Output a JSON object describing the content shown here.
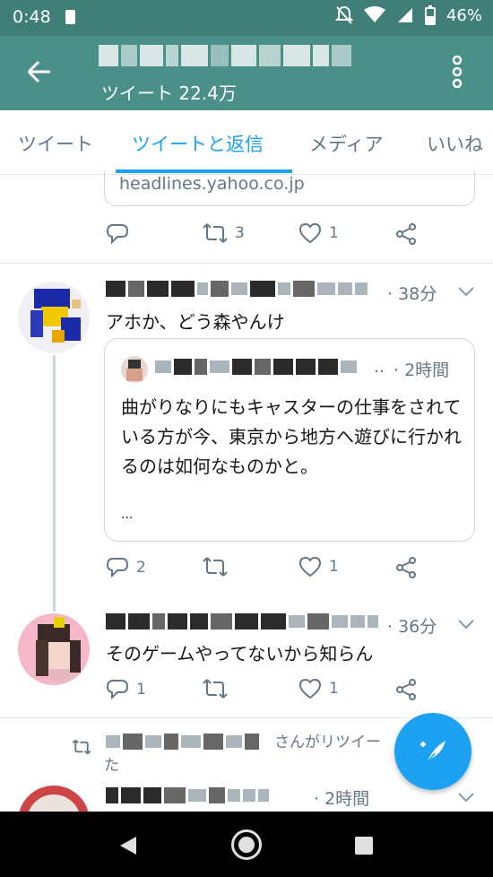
{
  "status_bar": {
    "time": "0:48",
    "battery": "46%"
  },
  "app_bar": {
    "subtitle": "ツイート 22.4万"
  },
  "tabs": [
    {
      "label": "ツイート",
      "active": false
    },
    {
      "label": "ツイートと返信",
      "active": true
    },
    {
      "label": "メディア",
      "active": false
    },
    {
      "label": "いいね",
      "active": false
    }
  ],
  "link_card": {
    "domain": "headlines.yahoo.co.jp"
  },
  "tweet0": {
    "retweets": "3",
    "likes": "1"
  },
  "tweet1": {
    "time": "· 38分",
    "text": "アホか、どう森やんけ",
    "quote": {
      "time": "· 2時間",
      "ellipsis_meta": "..",
      "text": "曲がりなりにもキャスターの仕事をされている方が今、東京から地方へ遊びに行かれるのは如何なものかと。",
      "more": "..."
    },
    "replies": "2",
    "likes": "1"
  },
  "tweet2": {
    "time": "· 36分",
    "text": "そのゲームやってないから知らん",
    "replies": "1",
    "likes": "1"
  },
  "retweet_notice": {
    "label": "さんがリツイー",
    "label_cont": "た"
  },
  "tweet3": {
    "time": "· 2時間"
  },
  "colors": {
    "header": "#4a8f88",
    "status_bar": "#3f7f78",
    "accent": "#1da1f2",
    "muted": "#657786"
  },
  "icons": [
    "back-arrow-icon",
    "more-vert-icon",
    "reply-icon",
    "retweet-icon",
    "like-icon",
    "share-icon",
    "chevron-down-icon",
    "compose-icon"
  ]
}
